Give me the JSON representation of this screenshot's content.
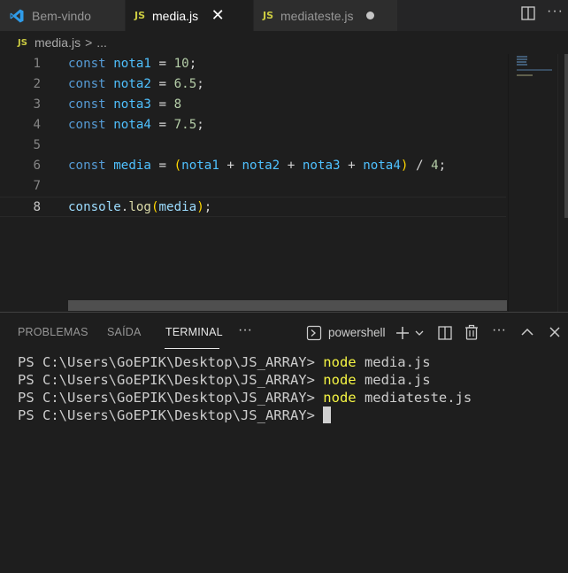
{
  "tabs": [
    {
      "label": "Bem-vindo",
      "icon": "vscode-logo-icon",
      "active": false
    },
    {
      "label": "media.js",
      "badge": "JS",
      "active": true,
      "closable": true
    },
    {
      "label": "mediateste.js",
      "badge": "JS",
      "active": false,
      "modified": true
    }
  ],
  "breadcrumb": {
    "badge": "JS",
    "file": "media.js",
    "separator": ">",
    "more": "..."
  },
  "editor": {
    "lines": [
      {
        "n": "1",
        "tokens": [
          [
            "kw",
            "const"
          ],
          [
            "pun",
            " "
          ],
          [
            "var",
            "nota1"
          ],
          [
            "pun",
            " = "
          ],
          [
            "num",
            "10"
          ],
          [
            "pun",
            ";"
          ]
        ]
      },
      {
        "n": "2",
        "tokens": [
          [
            "kw",
            "const"
          ],
          [
            "pun",
            " "
          ],
          [
            "var",
            "nota2"
          ],
          [
            "pun",
            " = "
          ],
          [
            "num",
            "6.5"
          ],
          [
            "pun",
            ";"
          ]
        ]
      },
      {
        "n": "3",
        "tokens": [
          [
            "kw",
            "const"
          ],
          [
            "pun",
            " "
          ],
          [
            "var",
            "nota3"
          ],
          [
            "pun",
            " = "
          ],
          [
            "num",
            "8"
          ]
        ]
      },
      {
        "n": "4",
        "tokens": [
          [
            "kw",
            "const"
          ],
          [
            "pun",
            " "
          ],
          [
            "var",
            "nota4"
          ],
          [
            "pun",
            " = "
          ],
          [
            "num",
            "7.5"
          ],
          [
            "pun",
            ";"
          ]
        ]
      },
      {
        "n": "5",
        "tokens": []
      },
      {
        "n": "6",
        "tokens": [
          [
            "kw",
            "const"
          ],
          [
            "pun",
            " "
          ],
          [
            "var",
            "media"
          ],
          [
            "pun",
            " = "
          ],
          [
            "paren2",
            "("
          ],
          [
            "var",
            "nota1"
          ],
          [
            "pun",
            " + "
          ],
          [
            "var",
            "nota2"
          ],
          [
            "pun",
            " + "
          ],
          [
            "var",
            "nota3"
          ],
          [
            "pun",
            " + "
          ],
          [
            "var",
            "nota4"
          ],
          [
            "paren2",
            ")"
          ],
          [
            "pun",
            " / "
          ],
          [
            "num",
            "4"
          ],
          [
            "pun",
            ";"
          ]
        ]
      },
      {
        "n": "7",
        "tokens": []
      },
      {
        "n": "8",
        "tokens": [
          [
            "obj",
            "console"
          ],
          [
            "pun",
            "."
          ],
          [
            "fn",
            "log"
          ],
          [
            "paren2",
            "("
          ],
          [
            "obj",
            "media"
          ],
          [
            "paren2",
            ")"
          ],
          [
            "pun",
            ";"
          ]
        ],
        "current": true
      }
    ]
  },
  "panel": {
    "tabs": [
      "PROBLEMAS",
      "SAÍDA",
      "TERMINAL"
    ],
    "active_tab": "TERMINAL",
    "more": "···",
    "terminal_name": "powershell",
    "terminal_lines": [
      {
        "prompt": "PS C:\\Users\\GoEPIK\\Desktop\\JS_ARRAY> ",
        "cmd": "node",
        "args": " media.js"
      },
      {
        "prompt": "PS C:\\Users\\GoEPIK\\Desktop\\JS_ARRAY> ",
        "cmd": "node",
        "args": " media.js"
      },
      {
        "prompt": "PS C:\\Users\\GoEPIK\\Desktop\\JS_ARRAY> ",
        "cmd": "node",
        "args": " mediateste.js"
      },
      {
        "prompt": "PS C:\\Users\\GoEPIK\\Desktop\\JS_ARRAY> ",
        "cmd": "",
        "args": "",
        "cursor": true
      }
    ]
  },
  "colors": {
    "keyword": "#569cd6",
    "variable": "#4fc1ff",
    "number": "#b5cea8",
    "command": "#f5f543",
    "js_badge": "#cbcb41"
  }
}
